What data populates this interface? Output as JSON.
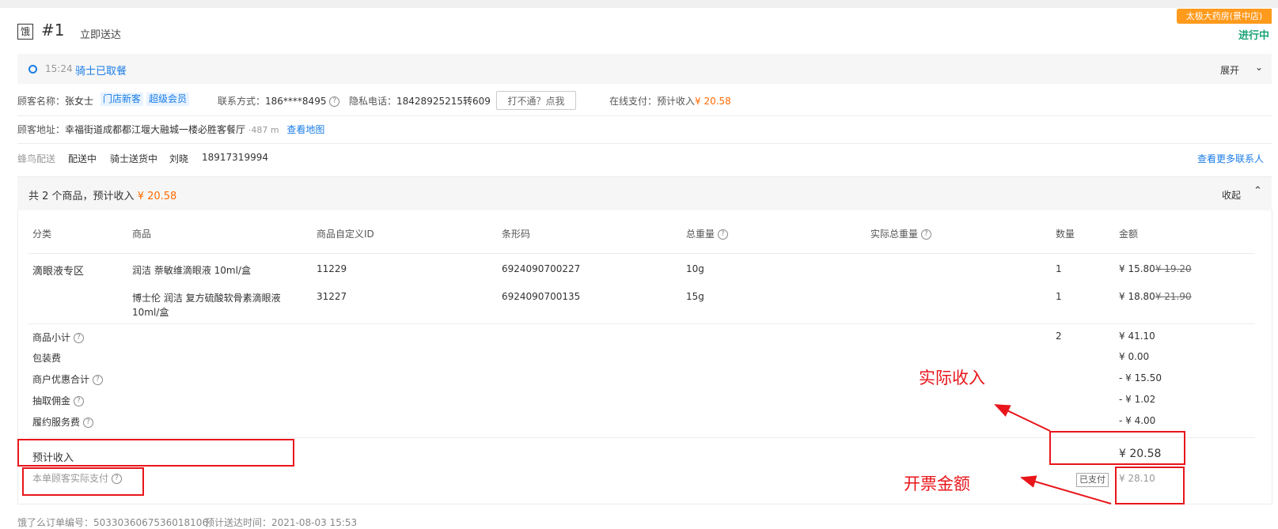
{
  "header": {
    "platform_icon": "饿",
    "order_number": "#1",
    "delivery_type": "立即送达",
    "store_name": "太极大药房(景中店)",
    "order_status": "进行中"
  },
  "status": {
    "time": "15:24",
    "text": "骑士已取餐",
    "expand_label": "展开",
    "expand_icon": "chevron-down-icon"
  },
  "customer": {
    "name_label": "顾客名称：",
    "name": "张女士",
    "tags": [
      "门店新客",
      "超级会员"
    ],
    "contact_label": "联系方式：",
    "contact": "186****8495",
    "privacy_label": "隐私电话：",
    "privacy_phone": "18428925215转609",
    "call_button": "打不通？点我",
    "payment_label": "在线支付：预计收入",
    "payment_amount": "¥ 20.58",
    "address_label": "顾客地址：",
    "address": "幸福街道成都都江堰大融城一楼必胜客餐厅",
    "distance": "487 m",
    "map_link": "查看地图"
  },
  "delivery": {
    "carrier": "蜂鸟配送",
    "state": "配送中",
    "rider_state": "骑士送货中",
    "rider_name": "刘晓",
    "rider_phone": "18917319994",
    "more_contacts": "查看更多联系人"
  },
  "goods": {
    "summary_prefix": "共 2 个商品，预计收入",
    "summary_amount": "¥ 20.58",
    "collapse_label": "收起",
    "collapse_icon": "chevron-up-icon",
    "columns": [
      "分类",
      "商品",
      "商品自定义ID",
      "条形码",
      "总重量",
      "实际总重量",
      "数量",
      "金额"
    ],
    "rows": [
      {
        "category": "滴眼液专区",
        "name": "润洁 萘敏维滴眼液 10ml/盒",
        "custom_id": "11229",
        "barcode": "6924090700227",
        "weight": "10g",
        "actual_weight": "",
        "qty": "1",
        "price": "¥ 15.80",
        "original_price": "¥ 19.20"
      },
      {
        "category": "",
        "name_line1": "博士伦 润洁 复方硫酸软骨素滴眼液",
        "name_line2": "10ml/盒",
        "custom_id": "31227",
        "barcode": "6924090700135",
        "weight": "15g",
        "actual_weight": "",
        "qty": "1",
        "price": "¥ 18.80",
        "original_price": "¥ 21.90"
      }
    ]
  },
  "summary": {
    "subtotal_label": "商品小计",
    "subtotal_qty": "2",
    "subtotal_amount": "¥ 41.10",
    "packing_label": "包装费",
    "packing_amount": "¥ 0.00",
    "discount_label": "商户优惠合计",
    "discount_amount": "- ¥ 15.50",
    "commission_label": "抽取佣金",
    "commission_amount": "- ¥ 1.02",
    "service_label": "履约服务费",
    "service_amount": "- ¥ 4.00",
    "estimated_label": "预计收入",
    "estimated_amount": "¥ 20.58",
    "paid_label": "本单顾客实际支付",
    "paid_badge": "已支付",
    "paid_amount": "¥ 28.10"
  },
  "annotations": {
    "actual_income": "实际收入",
    "invoice_amount": "开票金额",
    "color": "#e8161b"
  },
  "footer": {
    "order_id_label": "饿了么订单编号：",
    "order_id": "5033036067536018106",
    "eta_label": "预计送达时间：",
    "eta": "2021-08-03 15:53"
  },
  "colors": {
    "link": "#1b7de6",
    "price": "#ff6a00",
    "status_green": "#1aa377",
    "store_badge": "#ff9a1c"
  }
}
